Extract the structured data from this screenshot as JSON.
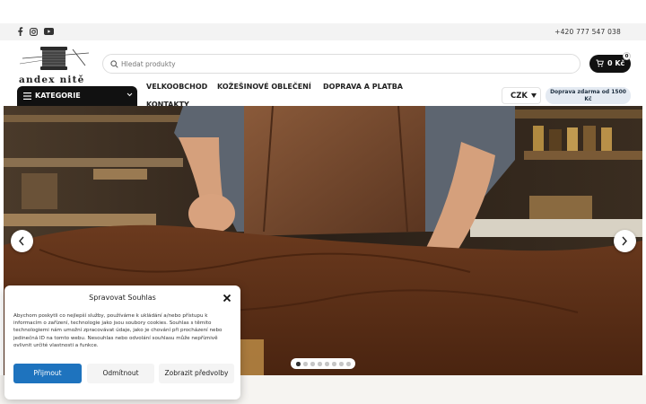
{
  "topbar": {
    "phone": "+420 777 547 038",
    "social_icons": [
      "facebook-icon",
      "instagram-icon",
      "youtube-icon"
    ]
  },
  "logo": {
    "text": "andex nitě"
  },
  "search": {
    "placeholder": "Hledat produkty"
  },
  "cart": {
    "total": "0 Kč",
    "count": "0"
  },
  "categories": {
    "label": "KATEGORIE"
  },
  "nav": {
    "items": [
      {
        "label": "VELKOOBCHOD"
      },
      {
        "label": "KOŽEŠINOVÉ OBLEČENÍ"
      },
      {
        "label": "DOPRAVA A PLATBA"
      },
      {
        "label": "KONTAKTY"
      }
    ]
  },
  "currency": {
    "selected": "CZK"
  },
  "shipping_badge": {
    "line1": "Doprava zdarma od 1500",
    "line2": "Kč"
  },
  "slider": {
    "slide_count": 8,
    "active_index": 0
  },
  "consent": {
    "title": "Spravovat Souhlas",
    "body": "Abychom poskytli co nejlepší služby, používáme k ukládání a/nebo přístupu k informacím o zařízení, technologie jako jsou soubory cookies. Souhlas s těmito technologiemi nám umožní zpracovávat údaje, jako je chování při procházení nebo jedinečná ID na tomto webu. Nesouhlas nebo odvolání souhlasu může nepříznivě ovlivnit určité vlastnosti a funkce.",
    "accept_label": "Přijmout",
    "deny_label": "Odmítnout",
    "prefs_label": "Zobrazit předvolby"
  },
  "colors": {
    "accent_blue": "#1e73be",
    "dark": "#111111",
    "shipping_bg": "#e4eaf2"
  }
}
